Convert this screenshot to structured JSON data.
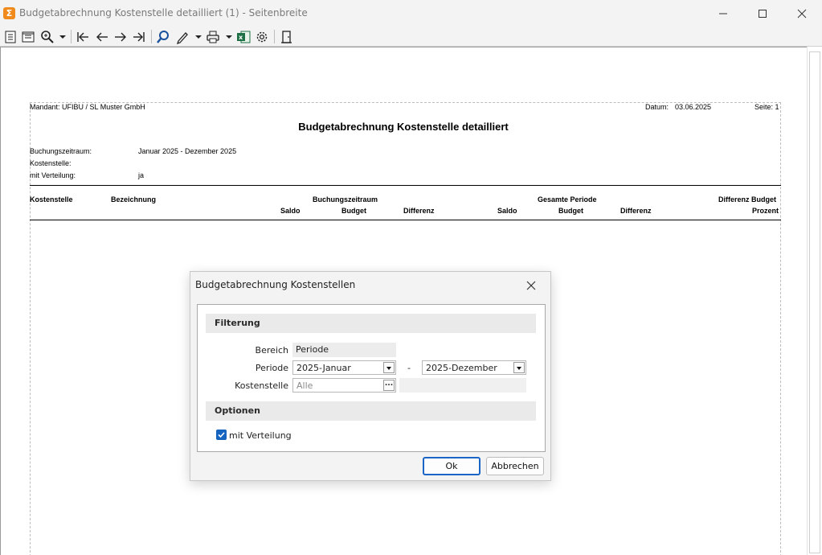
{
  "window": {
    "app_icon": "sigma-app-icon",
    "title": "Budgetabrechnung Kostenstelle detailliert (1) - Seitenbreite",
    "controls": [
      "minimize-icon",
      "maximize-icon",
      "close-icon"
    ]
  },
  "toolbar": {
    "icons": [
      "single-page-icon",
      "page-width-icon",
      "zoom-icon",
      "first-page-icon",
      "previous-page-icon",
      "next-page-icon",
      "last-page-icon",
      "search-icon",
      "edit-pen-icon",
      "print-icon",
      "excel-export-icon",
      "settings-gear-icon",
      "exit-door-icon"
    ]
  },
  "report": {
    "mandant": "Mandant: UFIBU / SL Muster GmbH",
    "datum_label": "Datum:",
    "datum_value": "03.06.2025",
    "seite": "Seite: 1",
    "title": "Budgetabrechnung Kostenstelle detailliert",
    "meta": [
      {
        "label": "Buchungszeitraum:",
        "value": "Januar 2025 - Dezember 2025"
      },
      {
        "label": "Kostenstelle:",
        "value": ""
      },
      {
        "label": "mit Verteilung:",
        "value": "ja"
      }
    ],
    "columns": {
      "kostenstelle": "Kostenstelle",
      "bezeichnung": "Bezeichnung",
      "group1": "Buchungszeitraum",
      "group2": "Gesamte Periode",
      "group3": "Differenz Budget",
      "saldo1": "Saldo",
      "budget1": "Budget",
      "differenz1": "Differenz",
      "saldo2": "Saldo",
      "budget2": "Budget",
      "differenz2": "Differenz",
      "prozent": "Prozent"
    }
  },
  "dialog": {
    "title": "Budgetabrechnung Kostenstellen",
    "section_filter": "Filterung",
    "bereich_label": "Bereich",
    "bereich_value": "Periode",
    "periode_label": "Periode",
    "periode_from": "2025-Januar",
    "periode_sep": "-",
    "periode_to": "2025-Dezember",
    "kostenstelle_label": "Kostenstelle",
    "kostenstelle_placeholder": "Alle",
    "lookup_button": "...",
    "section_options": "Optionen",
    "verteilung_label": "mit Verteilung",
    "verteilung_checked": true,
    "ok": "Ok",
    "cancel": "Abbrechen"
  }
}
